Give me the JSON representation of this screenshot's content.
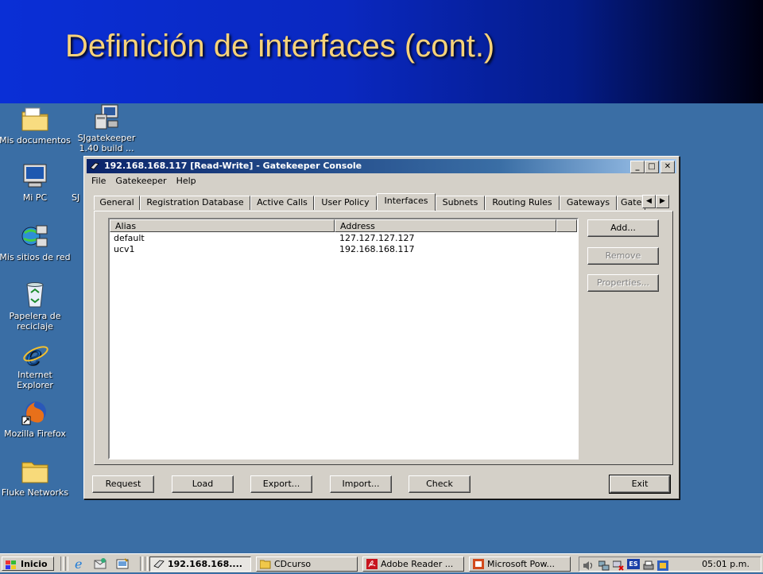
{
  "slide": {
    "title": "Definición de interfaces (cont.)"
  },
  "desktop_icons": [
    {
      "name": "my-documents",
      "label": "Mis documentos",
      "icon": "folder-documents-icon"
    },
    {
      "name": "sjgatekeeper",
      "label": "SJgatekeeper 1.40 build ...",
      "icon": "computer-app-icon"
    },
    {
      "name": "my-pc",
      "label": "Mi PC",
      "icon": "computer-icon"
    },
    {
      "name": "sj-truncated",
      "label": "SJ",
      "icon": ""
    },
    {
      "name": "network-places",
      "label": "Mis sitios de red",
      "icon": "network-icon"
    },
    {
      "name": "recycle-bin",
      "label": "Papelera de reciclaje",
      "icon": "recycle-bin-icon"
    },
    {
      "name": "internet-explorer",
      "label": "Internet Explorer",
      "icon": "ie-icon"
    },
    {
      "name": "mozilla-firefox",
      "label": "Mozilla Firefox",
      "icon": "firefox-icon"
    },
    {
      "name": "fluke-networks",
      "label": "Fluke Networks",
      "icon": "folder-icon"
    }
  ],
  "window": {
    "title": "192.168.168.117 [Read-Write] - Gatekeeper Console",
    "controls": {
      "minimize": "_",
      "maximize": "□",
      "close": "✕"
    },
    "menu": [
      "File",
      "Gatekeeper",
      "Help"
    ],
    "tabs": [
      "General",
      "Registration Database",
      "Active Calls",
      "User Policy",
      "Interfaces",
      "Subnets",
      "Routing Rules",
      "Gateways",
      "Gate"
    ],
    "active_tab": "Interfaces",
    "tab_scroll": {
      "left": "◀",
      "right": "▶"
    },
    "list": {
      "columns": [
        "Alias",
        "Address"
      ],
      "rows": [
        {
          "alias": "default",
          "address": "127.127.127.127"
        },
        {
          "alias": "ucv1",
          "address": "192.168.168.117"
        }
      ]
    },
    "side_buttons": {
      "add": "Add...",
      "remove": "Remove",
      "properties": "Properties..."
    },
    "bottom_buttons": {
      "request": "Request",
      "load": "Load",
      "export": "Export...",
      "import": "Import...",
      "check": "Check",
      "exit": "Exit"
    }
  },
  "taskbar": {
    "start_label": "Inicio",
    "tasks": [
      {
        "label": "192.168.168....",
        "active": true,
        "icon": "gatekeeper-icon"
      },
      {
        "label": "CDcurso",
        "active": false,
        "icon": "folder-icon"
      },
      {
        "label": "Adobe Reader ...",
        "active": false,
        "icon": "adobe-reader-icon"
      },
      {
        "label": "Microsoft Pow...",
        "active": false,
        "icon": "powerpoint-icon"
      }
    ],
    "tray": {
      "language": "ES",
      "clock": "05:01 p.m."
    }
  },
  "colors": {
    "desktop": "#3a6ea5",
    "title_text": "#f7d27a",
    "titlebar_start": "#0a246a",
    "window_face": "#d4d0c8"
  }
}
